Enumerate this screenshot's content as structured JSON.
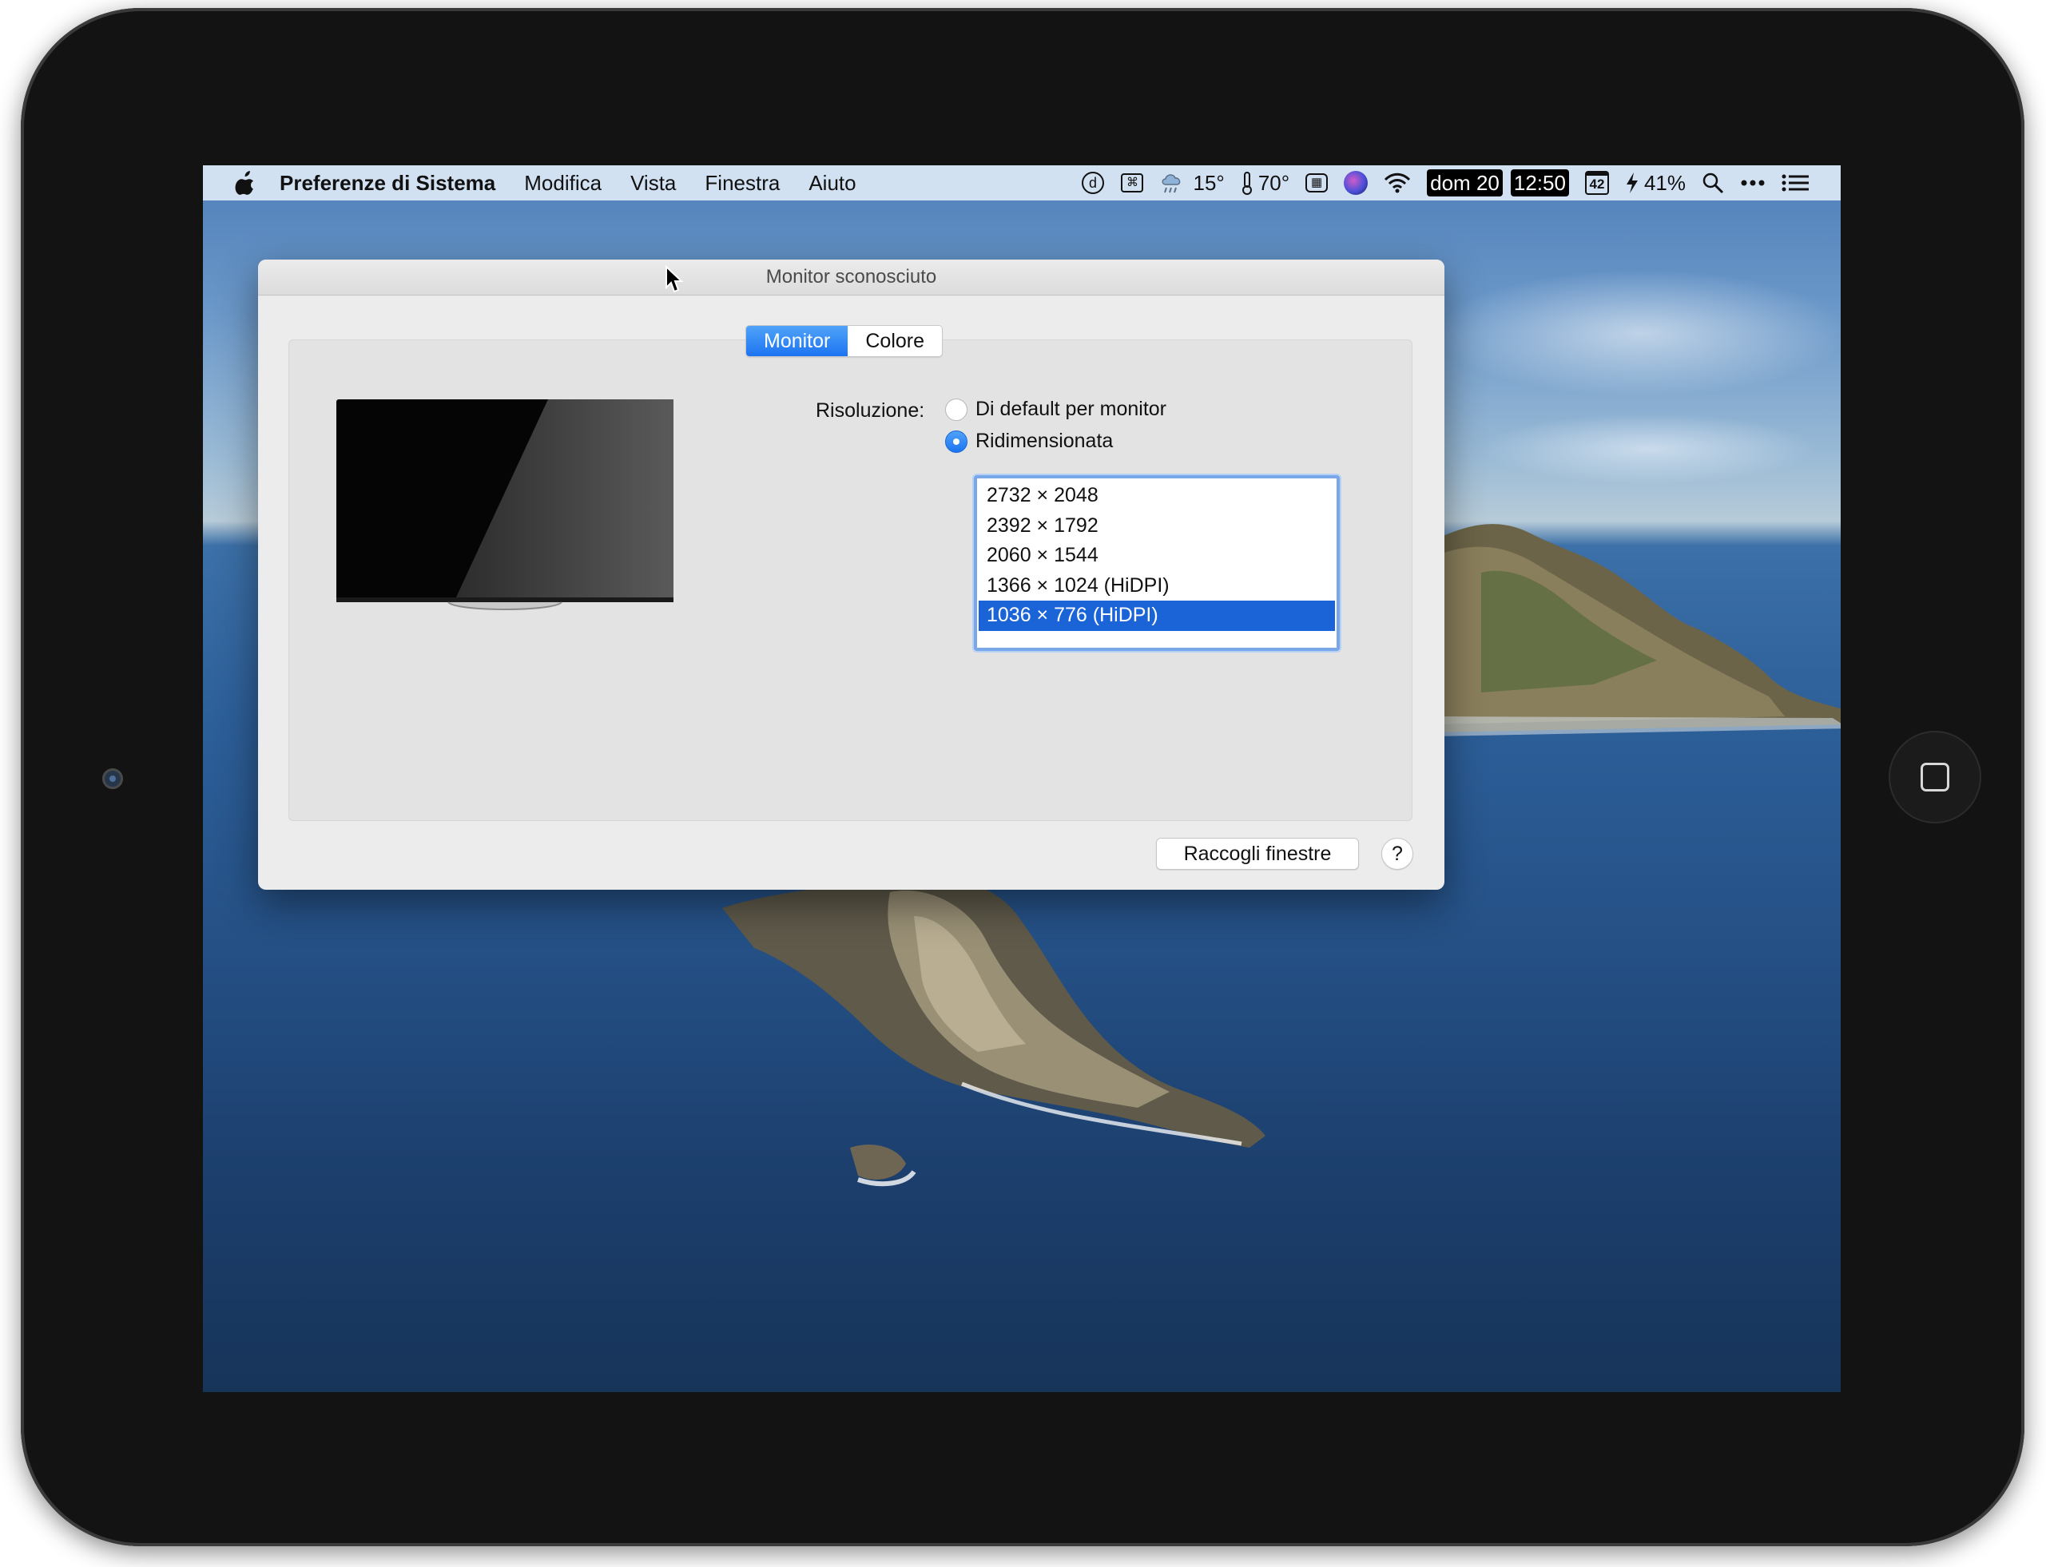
{
  "menubar": {
    "app_name": "Preferenze di Sistema",
    "items": [
      "Modifica",
      "Vista",
      "Finestra",
      "Aiuto"
    ],
    "status": {
      "dictionary_icon": "d",
      "weather_temp": "15°",
      "fan_value": "70°",
      "calendar_day": "42",
      "battery": "41%",
      "date": "dom 20",
      "time": "12:50"
    }
  },
  "window": {
    "title": "Monitor sconosciuto",
    "tabs": [
      {
        "label": "Monitor",
        "active": true
      },
      {
        "label": "Colore",
        "active": false
      }
    ],
    "resolution_label": "Risoluzione:",
    "options": [
      {
        "label": "Di default per monitor",
        "selected": false
      },
      {
        "label": "Ridimensionata",
        "selected": true
      }
    ],
    "resolutions": [
      {
        "label": "2732 × 2048",
        "selected": false
      },
      {
        "label": "2392 × 1792",
        "selected": false
      },
      {
        "label": "2060 × 1544",
        "selected": false
      },
      {
        "label": "1366 × 1024 (HiDPI)",
        "selected": false
      },
      {
        "label": "1036 × 776 (HiDPI)",
        "selected": true
      }
    ],
    "gather_button": "Raccogli finestre",
    "help_button": "?"
  },
  "colors": {
    "accent": "#1d74f2",
    "selection": "#1b64d8"
  }
}
